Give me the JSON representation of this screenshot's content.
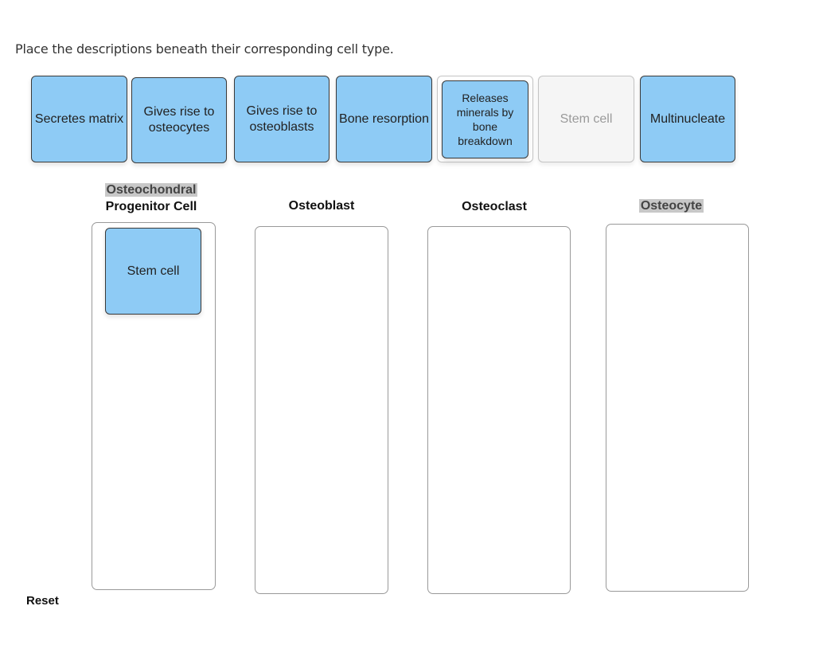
{
  "instructions": "Place the descriptions beneath their corresponding cell type.",
  "bank": {
    "cards": [
      {
        "label": "Secretes matrix"
      },
      {
        "label": "Gives rise to osteocytes"
      },
      {
        "label": "Gives rise to osteoblasts"
      },
      {
        "label": "Bone resorption"
      },
      {
        "label": "Releases minerals by bone breakdown"
      },
      {
        "placeholder": "Stem cell"
      },
      {
        "label": "Multinucleate"
      }
    ]
  },
  "columns": [
    {
      "title_line1": "Osteochondral",
      "title_line2": "Progenitor Cell",
      "placed": [
        "Stem cell"
      ]
    },
    {
      "title": "Osteoblast",
      "placed": []
    },
    {
      "title": "Osteoclast",
      "placed": []
    },
    {
      "title": "Osteocyte",
      "placed": []
    }
  ],
  "reset_label": "Reset",
  "colors": {
    "card_fill": "#8ecbf5",
    "card_border": "#3a3a3a",
    "highlight": "#c8c8c8"
  }
}
